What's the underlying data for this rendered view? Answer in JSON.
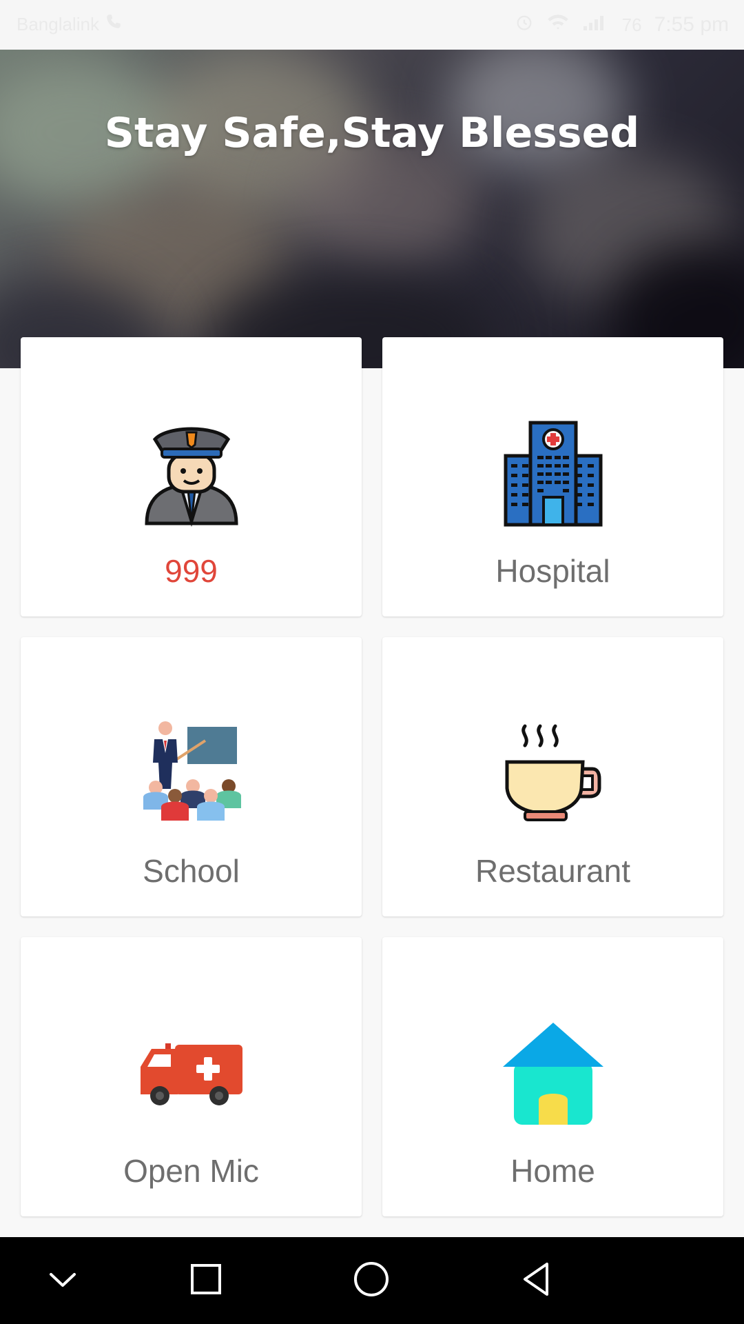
{
  "banner": {
    "title": "Stay Safe,Stay Blessed"
  },
  "status_bar": {
    "carrier": "Banglalink",
    "time": "7:55 pm",
    "battery": "76"
  },
  "cards": [
    {
      "label": "999",
      "icon": "police-officer-icon",
      "color": "#e0463a"
    },
    {
      "label": "Hospital",
      "icon": "hospital-building-icon",
      "color": "#6e6e6e"
    },
    {
      "label": "School",
      "icon": "teacher-classroom-icon",
      "color": "#6e6e6e"
    },
    {
      "label": "Restaurant",
      "icon": "coffee-cup-icon",
      "color": "#6e6e6e"
    },
    {
      "label": "Open Mic",
      "icon": "ambulance-icon",
      "color": "#6e6e6e"
    },
    {
      "label": "Home",
      "icon": "house-icon",
      "color": "#6e6e6e"
    }
  ],
  "nav": {
    "buttons": [
      "chevron-down-icon",
      "recent-apps-icon",
      "home-circle-icon",
      "back-triangle-icon"
    ]
  },
  "colors": {
    "accent": "#e0463a",
    "label": "#6e6e6e",
    "background": "#f8f8f8",
    "nav_bar": "#000000"
  }
}
